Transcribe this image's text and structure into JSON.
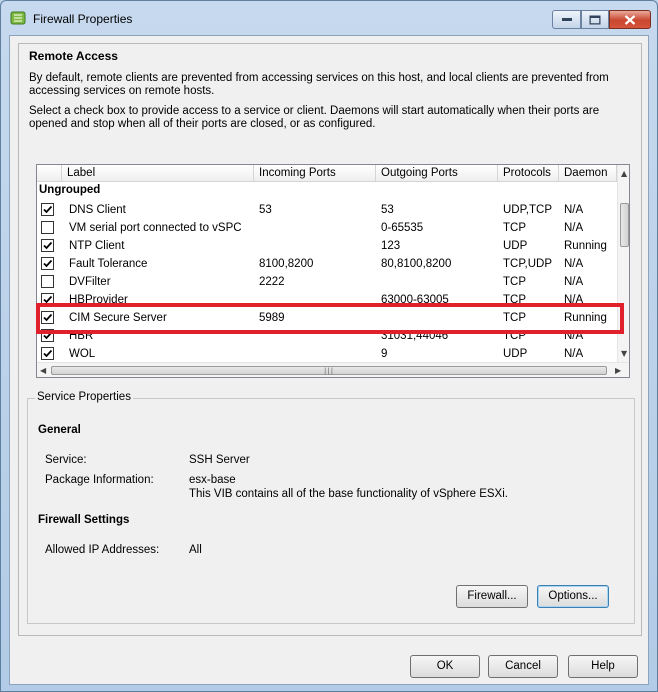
{
  "window": {
    "title": "Firewall Properties"
  },
  "remote_access": {
    "heading": "Remote Access",
    "description_1": "By default, remote clients are prevented from accessing services on this host, and local clients are prevented from accessing services on remote hosts.",
    "description_2": "Select a check box to provide access to a service or client. Daemons will start automatically when their ports are opened and stop when all of their ports are closed, or as configured."
  },
  "table": {
    "columns": [
      "Label",
      "Incoming Ports",
      "Outgoing Ports",
      "Protocols",
      "Daemon"
    ],
    "group": "Ungrouped",
    "rows": [
      {
        "checked": true,
        "label": "DNS Client",
        "incoming": "53",
        "outgoing": "53",
        "protocols": "UDP,TCP",
        "daemon": "N/A"
      },
      {
        "checked": false,
        "label": "VM serial port connected to vSPC",
        "incoming": "",
        "outgoing": "0-65535",
        "protocols": "TCP",
        "daemon": "N/A"
      },
      {
        "checked": true,
        "label": "NTP Client",
        "incoming": "",
        "outgoing": "123",
        "protocols": "UDP",
        "daemon": "Running"
      },
      {
        "checked": true,
        "label": "Fault Tolerance",
        "incoming": "8100,8200",
        "outgoing": "80,8100,8200",
        "protocols": "TCP,UDP",
        "daemon": "N/A"
      },
      {
        "checked": false,
        "label": "DVFilter",
        "incoming": "2222",
        "outgoing": "",
        "protocols": "TCP",
        "daemon": "N/A"
      },
      {
        "checked": true,
        "label": "HBProvider",
        "incoming": "",
        "outgoing": "63000-63005",
        "protocols": "TCP",
        "daemon": "N/A"
      },
      {
        "checked": true,
        "label": "CIM Secure Server",
        "incoming": "5989",
        "outgoing": "",
        "protocols": "TCP",
        "daemon": "Running"
      },
      {
        "checked": true,
        "label": "HBR",
        "incoming": "",
        "outgoing": "31031,44046",
        "protocols": "TCP",
        "daemon": "N/A"
      },
      {
        "checked": true,
        "label": "WOL",
        "incoming": "",
        "outgoing": "9",
        "protocols": "UDP",
        "daemon": "N/A"
      }
    ]
  },
  "service_properties": {
    "legend": "Service Properties",
    "general_heading": "General",
    "service_label": "Service:",
    "service_value": "SSH Server",
    "package_label": "Package Information:",
    "package_value": "esx-base",
    "package_desc": "This VIB contains all of the base functionality of vSphere ESXi.",
    "firewall_heading": "Firewall Settings",
    "allowed_ip_label": "Allowed IP Addresses:",
    "allowed_ip_value": "All",
    "firewall_button": "Firewall...",
    "options_button": "Options..."
  },
  "footer": {
    "ok": "OK",
    "cancel": "Cancel",
    "help": "Help"
  },
  "colors": {
    "highlight": "#e0202a",
    "check": "#000000"
  }
}
